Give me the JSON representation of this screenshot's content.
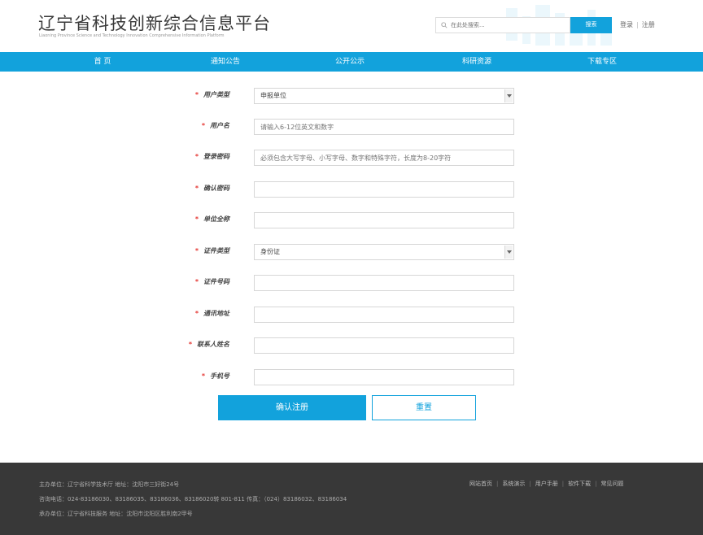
{
  "header": {
    "title": "辽宁省科技创新综合信息平台",
    "subtitle": "Liaoning Province Science and Technology Innovation Comprehensive Information Platform",
    "search_placeholder": "在此处搜索...",
    "search_button": "搜索",
    "login_link": "登录",
    "register_link": "注册"
  },
  "nav": {
    "items": [
      "首  页",
      "通知公告",
      "公开公示",
      "科研资源",
      "下载专区"
    ]
  },
  "form": {
    "fields": [
      {
        "label": "用户类型",
        "value": "申报单位",
        "placeholder": "",
        "type": "select"
      },
      {
        "label": "用户名",
        "value": "",
        "placeholder": "请输入6-12位英文和数字",
        "type": "text"
      },
      {
        "label": "登录密码",
        "value": "",
        "placeholder": "必须包含大写字母、小写字母、数字和特殊字符，长度为8-20字符",
        "type": "text"
      },
      {
        "label": "确认密码",
        "value": "",
        "placeholder": "",
        "type": "text"
      },
      {
        "label": "单位全称",
        "value": "",
        "placeholder": "",
        "type": "text"
      },
      {
        "label": "证件类型",
        "value": "身份证",
        "placeholder": "",
        "type": "select"
      },
      {
        "label": "证件号码",
        "value": "",
        "placeholder": "",
        "type": "text"
      },
      {
        "label": "通讯地址",
        "value": "",
        "placeholder": "",
        "type": "text"
      },
      {
        "label": "联系人姓名",
        "value": "",
        "placeholder": "",
        "type": "text"
      },
      {
        "label": "手机号",
        "value": "",
        "placeholder": "",
        "type": "text"
      }
    ],
    "required_mark": "*",
    "submit_label": "确认注册",
    "reset_label": "重置"
  },
  "footer": {
    "line1": "主办单位：辽宁省科学技术厅  地址：沈阳市三好街24号",
    "line2": "咨询电话：024-83186030、83186035、83186036、83186020转 801-811  传真：（024）83186032、83186034",
    "line3": "承办单位：辽宁省科技服务  地址：沈阳市沈阳区胜利南2甲号",
    "links": [
      "网站首页",
      "系统演示",
      "用户手册",
      "软件下载",
      "常见问题"
    ]
  },
  "colors": {
    "accent": "#12a2dc",
    "footer_bg": "#383838",
    "required": "#e53935"
  }
}
